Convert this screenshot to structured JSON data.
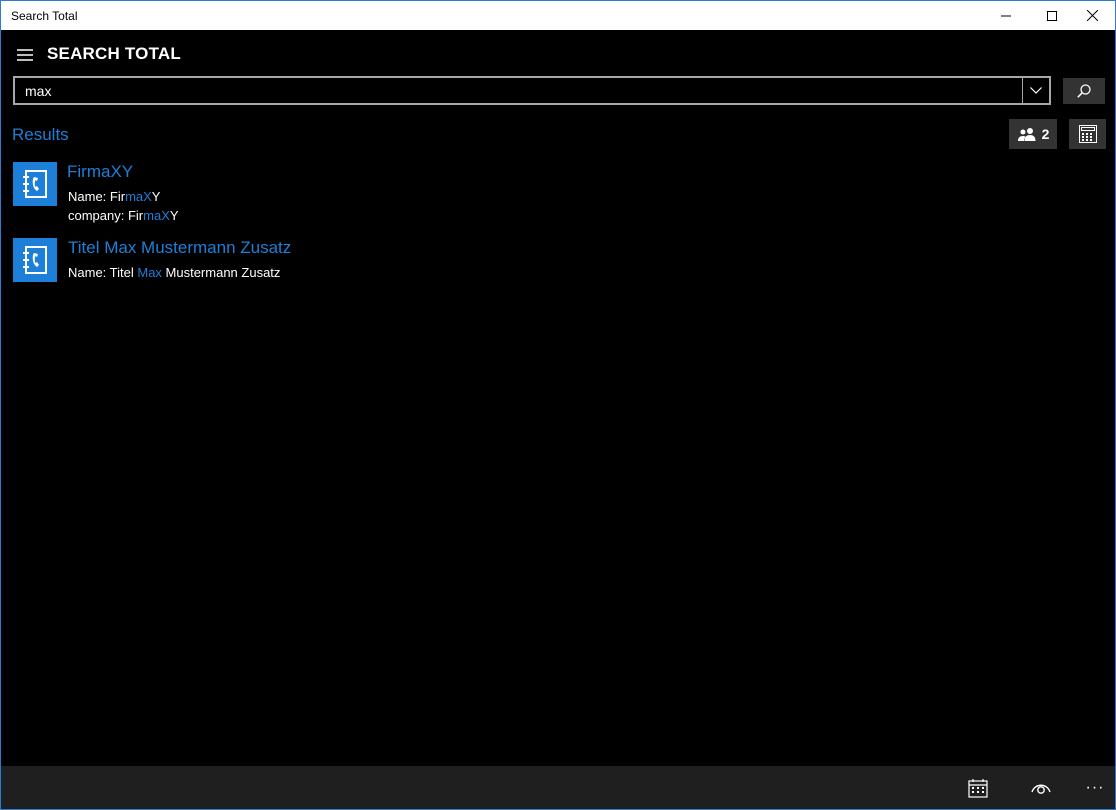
{
  "window": {
    "title": "Search Total"
  },
  "header": {
    "app_title": "SEARCH TOTAL"
  },
  "search": {
    "value": "max"
  },
  "results": {
    "label": "Results",
    "contacts_count": "2",
    "items": [
      {
        "title": "FirmaXY",
        "lines": [
          {
            "prefix": "Name: Fir",
            "match": "maX",
            "suffix": "Y"
          },
          {
            "prefix": "company: Fir",
            "match": "maX",
            "suffix": "Y"
          }
        ]
      },
      {
        "title": "Titel Max Mustermann Zusatz",
        "lines": [
          {
            "prefix": "Name: Titel ",
            "match": "Max",
            "suffix": " Mustermann Zusatz"
          }
        ]
      }
    ]
  },
  "bottombar": {
    "more_label": "···"
  },
  "colors": {
    "accent": "#1e7fd8",
    "button_bg": "#333333",
    "bottombar_bg": "#1f1f1f"
  }
}
